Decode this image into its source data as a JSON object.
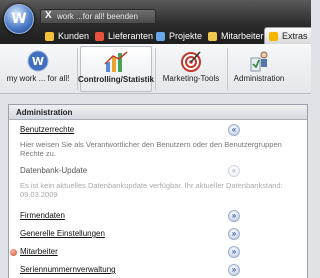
{
  "window": {
    "app_orb_letter": "W",
    "doc_tab_title": "work ...for all! beenden",
    "close_glyph": "X"
  },
  "nav": [
    {
      "label": "Kunden",
      "icon": "kunden-icon",
      "color": "#f2c23a"
    },
    {
      "label": "Lieferanten",
      "icon": "lieferanten-icon",
      "color": "#e8523c"
    },
    {
      "label": "Projekte",
      "icon": "projekte-icon",
      "color": "#6aa7e8"
    },
    {
      "label": "Mitarbeiter",
      "icon": "mitarbeiter-icon",
      "color": "#f1c84e"
    },
    {
      "label": "Extras",
      "icon": "extras-icon",
      "color": "#f4b400"
    }
  ],
  "ribbon": {
    "buttons": [
      {
        "label": "my work ... for all!",
        "icon": "app-orb-icon"
      },
      {
        "label": "Controlling/Statistik",
        "icon": "controlling-icon"
      },
      {
        "label": "Marketing-Tools",
        "icon": "marketing-icon"
      },
      {
        "label": "Administration",
        "icon": "administration-icon"
      }
    ]
  },
  "panel": {
    "title": "Administration",
    "sections": [
      {
        "label": "Benutzerrechte",
        "expanded": true,
        "enabled": true,
        "description": "Hier weisen Sie als Verantwortlicher den Benutzern oder den Benutzergruppen Rechte zu."
      },
      {
        "label": "Datenbank-Update",
        "expanded": true,
        "enabled": false,
        "description": "Es ist kein aktuelles Datenbankupdate verfügbar. Ihr aktueller Datenbankstand: 09.03.2009"
      },
      {
        "label": "Firmendaten",
        "expanded": false,
        "enabled": true
      },
      {
        "label": "Generelle Einstellungen",
        "expanded": false,
        "enabled": true
      },
      {
        "label": "Mitarbeiter",
        "expanded": false,
        "enabled": true,
        "marked": true
      },
      {
        "label": "Seriennummernverwaltung",
        "expanded": false,
        "enabled": true
      }
    ],
    "collapse_glyph": "«",
    "expand_glyph": "»"
  }
}
